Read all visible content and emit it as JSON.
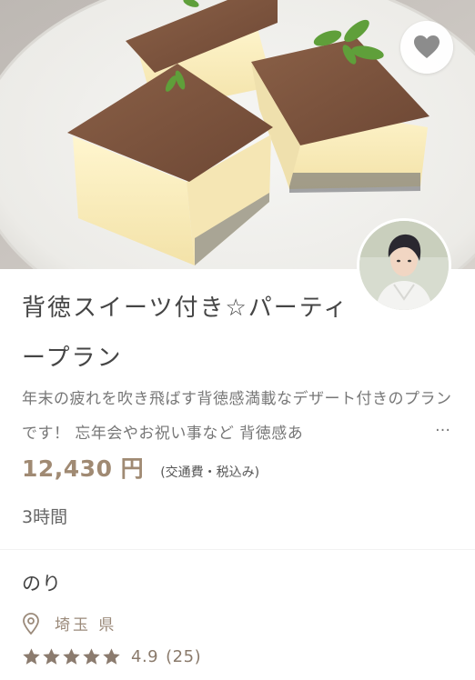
{
  "listing": {
    "title": "背徳スイーツ付き☆パーティープラン",
    "description": "年末の疲れを吹き飛ばす背徳感満載なデザート付きのプランです！ 忘年会やお祝い事など 背徳感あ",
    "description_ellipsis": "…",
    "price": "12,430 円",
    "price_note": "(交通費・税込み)",
    "duration": "3時間",
    "favorited": false
  },
  "provider": {
    "name": "のり",
    "location": "埼玉 県",
    "rating_value": "4.9",
    "rating_count": "(25)",
    "stars": 5
  },
  "colors": {
    "accent": "#a08a73",
    "star": "#8b7b6e",
    "pin": "#9b8a7a"
  },
  "icons": {
    "favorite": "heart-icon",
    "location": "map-pin-icon",
    "rating": "star-icon"
  }
}
